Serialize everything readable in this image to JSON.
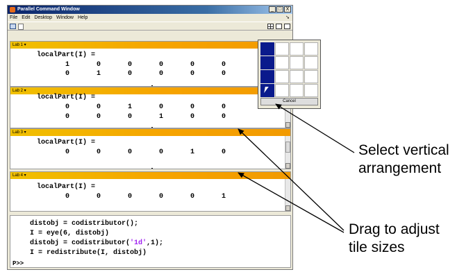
{
  "window": {
    "title": "Parallel Command Window",
    "buttons": [
      "_",
      "□",
      "X"
    ]
  },
  "menu": [
    "File",
    "Edit",
    "Desktop",
    "Window",
    "Help"
  ],
  "labs": [
    {
      "header": "Lab 1 ▾",
      "expr": "localPart(I) =",
      "rows": [
        [
          "1",
          "0",
          "0",
          "0",
          "0",
          "0"
        ],
        [
          "0",
          "1",
          "0",
          "0",
          "0",
          "0"
        ]
      ]
    },
    {
      "header": "Lab 2 ▾",
      "expr": "localPart(I) =",
      "rows": [
        [
          "0",
          "0",
          "1",
          "0",
          "0",
          "0"
        ],
        [
          "0",
          "0",
          "0",
          "1",
          "0",
          "0"
        ]
      ]
    },
    {
      "header": "Lab 3 ▾",
      "expr": "localPart(I) =",
      "rows": [
        [
          "0",
          "0",
          "0",
          "0",
          "1",
          "0"
        ]
      ]
    },
    {
      "header": "Lab 4 ▾",
      "expr": "localPart(I) =",
      "rows": [
        [
          "0",
          "0",
          "0",
          "0",
          "0",
          "1"
        ]
      ]
    }
  ],
  "command": {
    "lines": [
      {
        "pre": "distobj = codistributor();",
        "str": "",
        "post": ""
      },
      {
        "pre": "I = eye(6, distobj)",
        "str": "",
        "post": ""
      },
      {
        "pre": "distobj = codistributor(",
        "str": "'1d'",
        "post": ",1);"
      },
      {
        "pre": "I = redistribute(I, distobj)",
        "str": "",
        "post": ""
      }
    ],
    "prompt": "P>>"
  },
  "popup": {
    "cancel_label": "Cancel",
    "selected_column": 1,
    "selected_rows": 4
  },
  "callouts": {
    "select_line1": "Select vertical",
    "select_line2": "arrangement",
    "drag_line1": "Drag to adjust",
    "drag_line2": "tile sizes"
  },
  "colors": {
    "header_yellow": "#f0c000",
    "header_orange": "#f29a00",
    "grid_selected": "#0a1a8c",
    "string": "#a020f0"
  }
}
